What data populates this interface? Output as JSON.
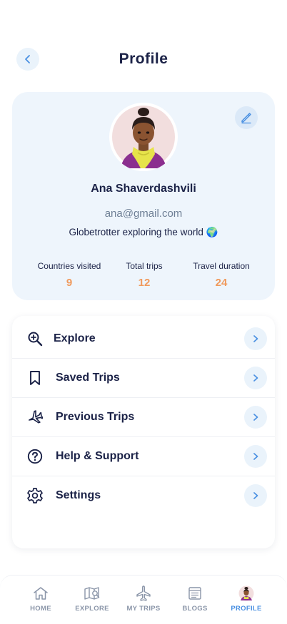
{
  "header": {
    "title": "Profile"
  },
  "profile": {
    "name": "Ana Shaverdashvili",
    "email": "ana@gmail.com",
    "bio": "Globetrotter exploring the world 🌍",
    "stats": [
      {
        "label": "Countries visited",
        "value": "9"
      },
      {
        "label": "Total trips",
        "value": "12"
      },
      {
        "label": "Travel duration",
        "value": "24"
      }
    ]
  },
  "menu": {
    "items": [
      {
        "label": "Explore",
        "icon": "search-plus-icon"
      },
      {
        "label": "Saved Trips",
        "icon": "bookmark-icon"
      },
      {
        "label": "Previous Trips",
        "icon": "airplane-icon"
      },
      {
        "label": "Help & Support",
        "icon": "help-circle-icon"
      },
      {
        "label": "Settings",
        "icon": "gear-icon"
      }
    ]
  },
  "nav": {
    "items": [
      {
        "label": "HOME",
        "icon": "home-icon"
      },
      {
        "label": "EXPLORE",
        "icon": "map-icon"
      },
      {
        "label": "MY TRIPS",
        "icon": "airplane-icon"
      },
      {
        "label": "BLOGS",
        "icon": "blog-icon"
      },
      {
        "label": "PROFILE",
        "icon": "avatar-icon",
        "active": true
      }
    ]
  },
  "colors": {
    "primary_text": "#1b2247",
    "accent_orange": "#f09a5d",
    "accent_blue": "#4a90e2",
    "card_bg": "#eef5fc"
  }
}
